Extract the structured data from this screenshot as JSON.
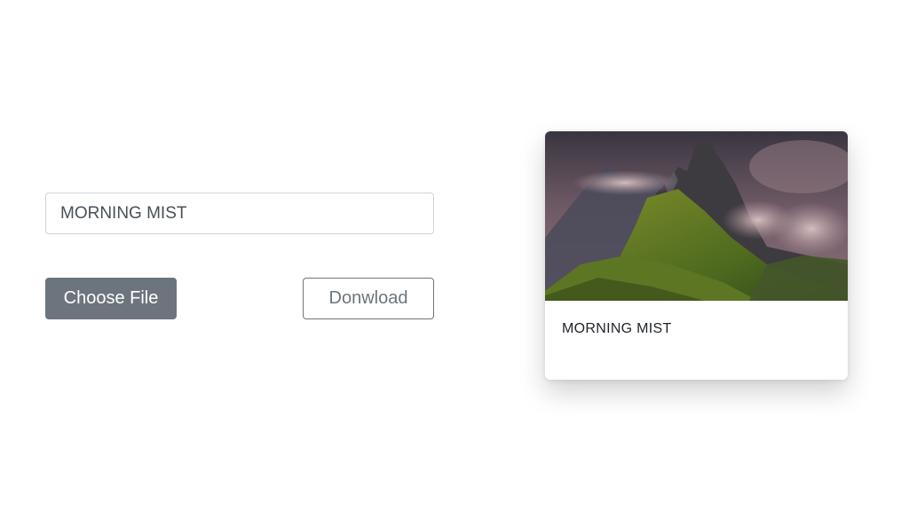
{
  "form": {
    "title_value": "MORNING MIST",
    "choose_file_label": "Choose File",
    "download_label": "Donwload"
  },
  "card": {
    "caption": "MORNING MIST",
    "image_subject": "mountain-landscape-image"
  },
  "colors": {
    "secondary_button": "#6c757d",
    "input_border": "#ced4da",
    "card_text": "#212529"
  }
}
